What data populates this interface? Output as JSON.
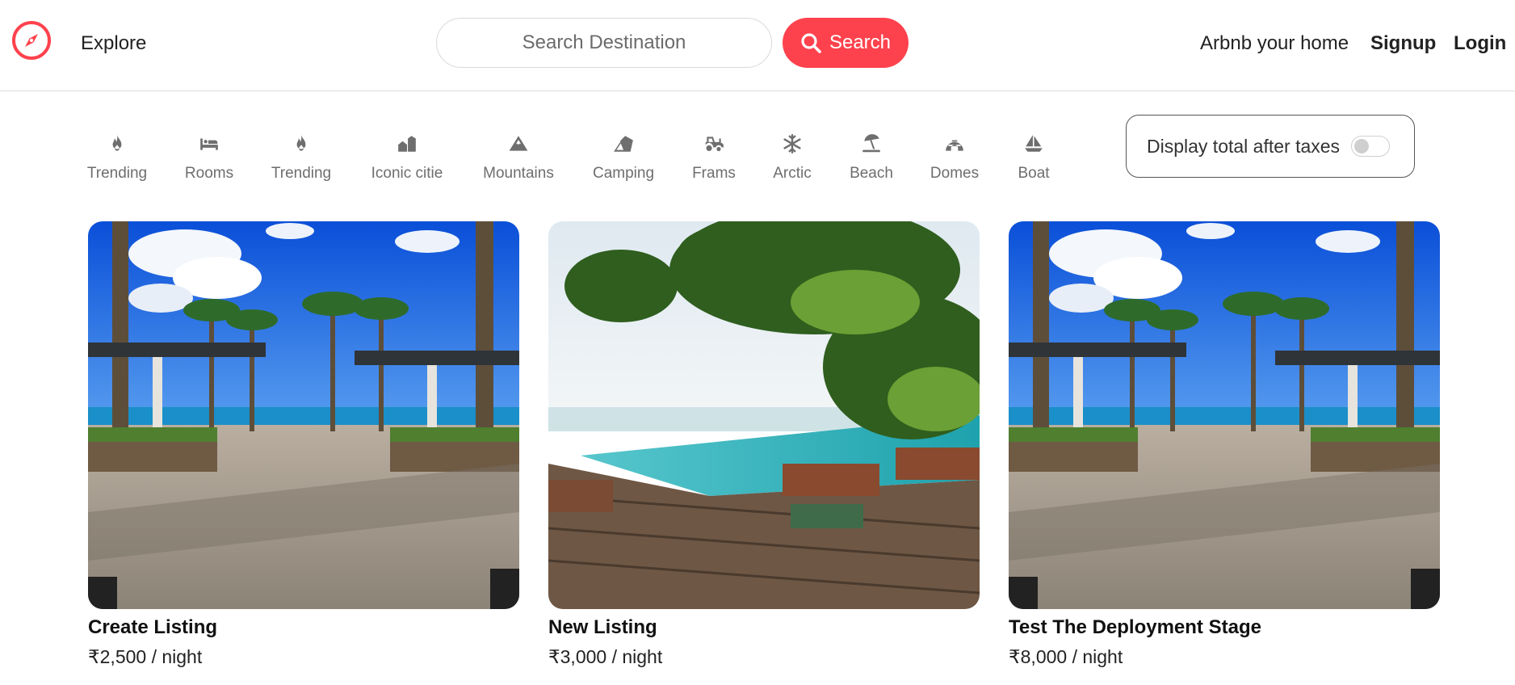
{
  "header": {
    "logo_icon": "compass-icon",
    "explore_label": "Explore",
    "search_placeholder": "Search Destination",
    "search_button_label": "Search",
    "host_label": "Arbnb your home",
    "signup_label": "Signup",
    "login_label": "Login",
    "accent_color": "#fe424d"
  },
  "filters": [
    {
      "label": "Trending",
      "icon": "fire-icon"
    },
    {
      "label": "Rooms",
      "icon": "bed-icon"
    },
    {
      "label": "Trending",
      "icon": "fire-icon"
    },
    {
      "label": "Iconic citie",
      "icon": "city-icon"
    },
    {
      "label": "Mountains",
      "icon": "mountain-icon"
    },
    {
      "label": "Camping",
      "icon": "campground-icon"
    },
    {
      "label": "Frams",
      "icon": "tractor-icon"
    },
    {
      "label": "Arctic",
      "icon": "snowflake-icon"
    },
    {
      "label": "Beach",
      "icon": "umbrella-beach-icon"
    },
    {
      "label": "Domes",
      "icon": "igloo-icon"
    },
    {
      "label": "Boat",
      "icon": "sailboat-icon"
    }
  ],
  "tax_toggle": {
    "label": "Display total after taxes",
    "enabled": false
  },
  "listings": [
    {
      "title": "Create Listing",
      "price": "₹2,500 / night",
      "photo": "beach-resort-palms"
    },
    {
      "title": "New Listing",
      "price": "₹3,000 / night",
      "photo": "infinity-pool-deck"
    },
    {
      "title": "Test The Deployment Stage",
      "price": "₹8,000 / night",
      "photo": "beach-resort-palms"
    }
  ]
}
